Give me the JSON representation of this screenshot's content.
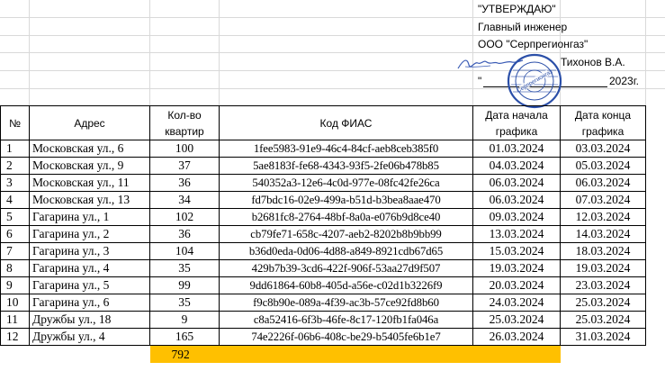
{
  "approval": {
    "title": "\"УТВЕРЖДАЮ\"",
    "position": "Главный инженер",
    "company": "ООО \"Серпрегионгаз\"",
    "name": "Тихонов В.А.",
    "date_prefix": "\"",
    "date_suffix": "2023г."
  },
  "stamp": {
    "text": "Серпрегионгаз",
    "color": "#2b4fa8"
  },
  "table": {
    "headers": {
      "num": "№",
      "address": "Адрес",
      "count_l1": "Кол-во",
      "count_l2": "квартир",
      "fias": "Код ФИАС",
      "start_l1": "Дата начала",
      "start_l2": "графика",
      "end_l1": "Дата конца",
      "end_l2": "графика"
    },
    "rows": [
      {
        "num": "1",
        "address": "Московская ул., 6",
        "count": "100",
        "fias": "1fee5983-91e9-46c4-84cf-aeb8ceb385f0",
        "start": "01.03.2024",
        "end": "03.03.2024"
      },
      {
        "num": "2",
        "address": "Московская ул., 9",
        "count": "37",
        "fias": "5ae8183f-fe68-4343-93f5-2fe06b478b85",
        "start": "04.03.2024",
        "end": "05.03.2024"
      },
      {
        "num": "3",
        "address": "Московская ул., 11",
        "count": "36",
        "fias": "540352a3-12e6-4c0d-977e-08fc42fe26ca",
        "start": "06.03.2024",
        "end": "06.03.2024"
      },
      {
        "num": "4",
        "address": "Московская ул., 13",
        "count": "34",
        "fias": "fd7bdc16-02e9-499a-b51d-b3bea8aae470",
        "start": "06.03.2024",
        "end": "07.03.2024"
      },
      {
        "num": "5",
        "address": "Гагарина ул., 1",
        "count": "102",
        "fias": "b2681fc8-2764-48bf-8a0a-e076b9d8ce40",
        "start": "09.03.2024",
        "end": "12.03.2024"
      },
      {
        "num": "6",
        "address": "Гагарина ул., 2",
        "count": "36",
        "fias": "cb79fe71-658c-4207-aeb2-8202b8b9bb99",
        "start": "13.03.2024",
        "end": "14.03.2024"
      },
      {
        "num": "7",
        "address": "Гагарина ул., 3",
        "count": "104",
        "fias": "b36d0eda-0d06-4d88-a849-8921cdb67d65",
        "start": "15.03.2024",
        "end": "18.03.2024"
      },
      {
        "num": "8",
        "address": "Гагарина ул., 4",
        "count": "35",
        "fias": "429b7b39-3cd6-422f-906f-53aa27d9f507",
        "start": "19.03.2024",
        "end": "19.03.2024"
      },
      {
        "num": "9",
        "address": "Гагарина ул., 5",
        "count": "99",
        "fias": "9dd61864-60b8-405d-a56e-c02d1b3226f9",
        "start": "20.03.2024",
        "end": "23.03.2024"
      },
      {
        "num": "10",
        "address": "Гагарина ул., 6",
        "count": "35",
        "fias": "f9c8b90e-089a-4f39-ac3b-57ce92fd8b60",
        "start": "24.03.2024",
        "end": "25.03.2024"
      },
      {
        "num": "11",
        "address": "Дружбы ул., 18",
        "count": "9",
        "fias": "c8a52416-6f3b-46fe-8c17-120fb1fa046a",
        "start": "25.03.2024",
        "end": "25.03.2024"
      },
      {
        "num": "12",
        "address": "Дружбы ул., 4",
        "count": "165",
        "fias": "74e2226f-06b6-408c-be29-b5405fe6b1e7",
        "start": "26.03.2024",
        "end": "31.03.2024"
      }
    ],
    "total": "792",
    "highlight_color": "#ffc000"
  }
}
